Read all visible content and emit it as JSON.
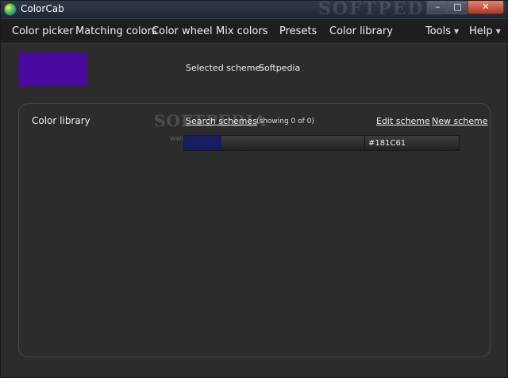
{
  "window": {
    "title": "ColorCab",
    "watermark": "SOFTPEDIA",
    "controls": {
      "minimize": "–",
      "maximize": "□",
      "close": "✕"
    }
  },
  "menu": {
    "items": [
      {
        "label": "Color picker"
      },
      {
        "label": "Matching colors"
      },
      {
        "label": "Color wheel"
      },
      {
        "label": "Mix colors"
      },
      {
        "label": "Presets"
      },
      {
        "label": "Color library"
      },
      {
        "label": "Tools",
        "has_dropdown": true
      },
      {
        "label": "Help",
        "has_dropdown": true
      }
    ],
    "dropdown_arrow": "▼"
  },
  "header": {
    "swatch_color": "#4A0AA0",
    "selected_label": "Selected scheme:",
    "selected_value": "Softpedia"
  },
  "library": {
    "title": "Color library",
    "search_link": "Search schemes",
    "showing": "(showing 0 of 0)",
    "edit_link": "Edit scheme",
    "new_link": "New scheme",
    "watermark": "SOFTPEDIA",
    "watermark_url": "www.softpedia.com",
    "scheme": {
      "color": "#181C61",
      "hex_label": "#181C61"
    }
  }
}
